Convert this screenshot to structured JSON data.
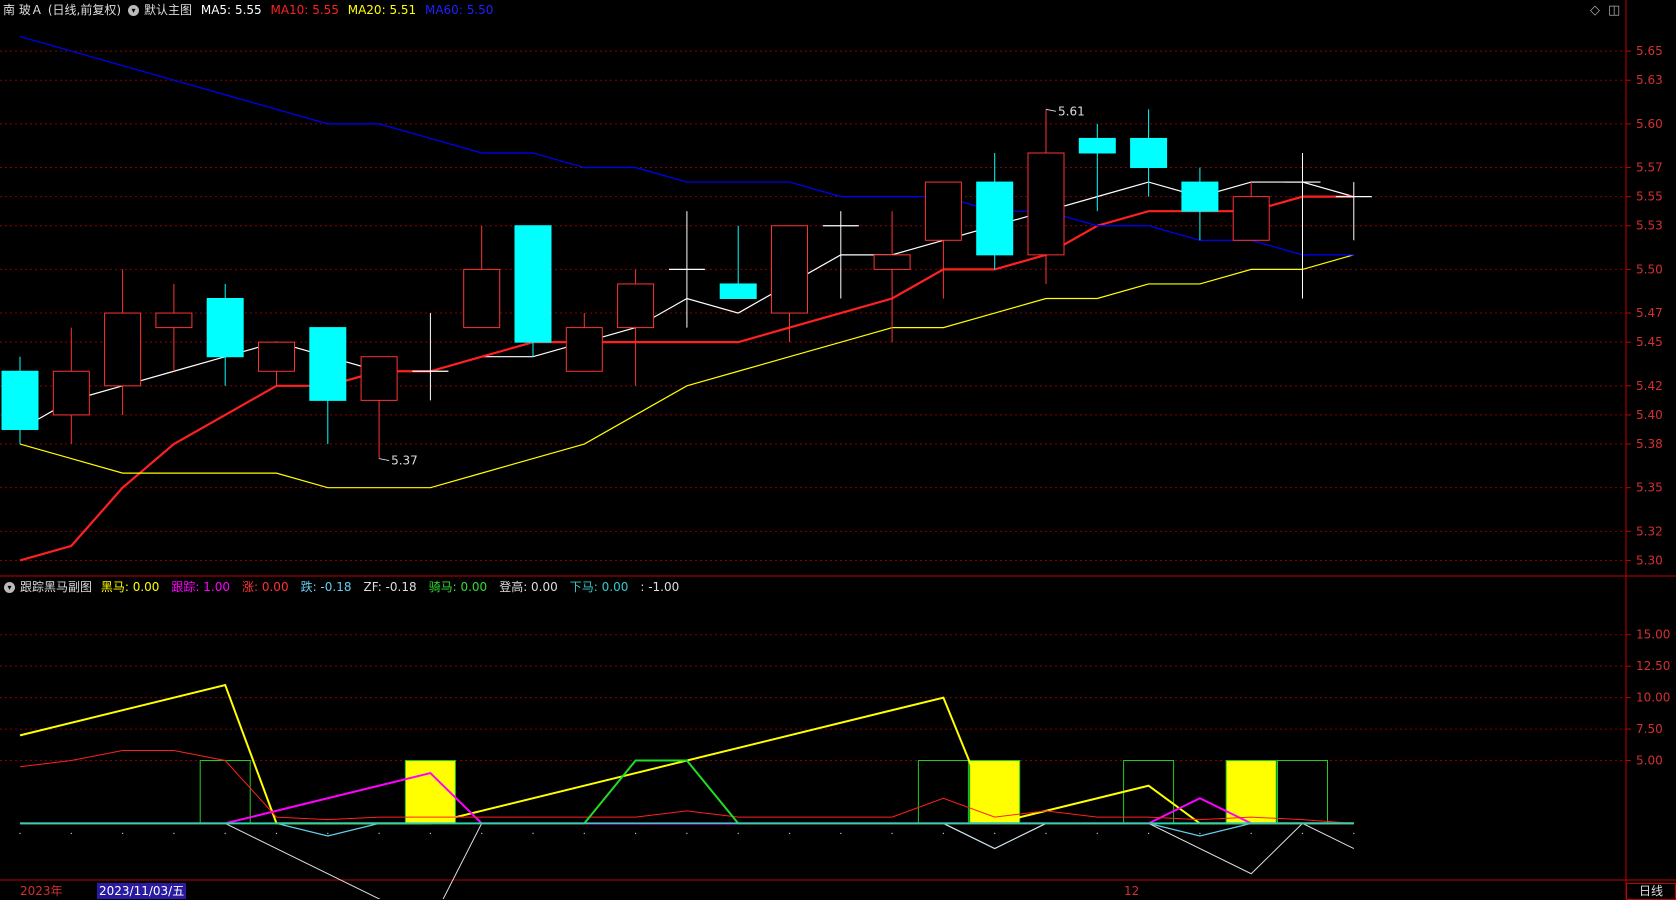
{
  "header": {
    "stock_name": "南 玻Ａ",
    "period": "(日线,前复权)",
    "template": "默认主图",
    "ma5_label": "MA5:",
    "ma5_value": "5.55",
    "ma10_label": "MA10:",
    "ma10_value": "5.55",
    "ma20_label": "MA20:",
    "ma20_value": "5.51",
    "ma60_label": "MA60:",
    "ma60_value": "5.50"
  },
  "sub_header": {
    "title": "跟踪黑马副图",
    "items": [
      {
        "label": "黑马:",
        "value": "0.00",
        "color": "#ffff00"
      },
      {
        "label": "跟踪:",
        "value": "1.00",
        "color": "#ff00ff"
      },
      {
        "label": "涨:",
        "value": "0.00",
        "color": "#ff3333"
      },
      {
        "label": "跌:",
        "value": "-0.18",
        "color": "#66ccee"
      },
      {
        "label": "ZF:",
        "value": "-0.18",
        "color": "#dddddd"
      },
      {
        "label": "骑马:",
        "value": "0.00",
        "color": "#33dd33"
      },
      {
        "label": "登高:",
        "value": "0.00",
        "color": "#dddddd"
      },
      {
        "label": "下马:",
        "value": "0.00",
        "color": "#33cccc"
      },
      {
        "label": ":",
        "value": "-1.00",
        "color": "#dddddd"
      }
    ]
  },
  "price_axis": [
    "5.65",
    "5.63",
    "5.60",
    "5.57",
    "5.55",
    "5.53",
    "5.50",
    "5.47",
    "5.45",
    "5.42",
    "5.40",
    "5.38",
    "5.35",
    "5.32",
    "5.30"
  ],
  "sub_axis": [
    "15.00",
    "12.50",
    "10.00",
    "7.50",
    "5.00"
  ],
  "date_axis": {
    "year": "2023年",
    "cursor_date": "2023/11/03/五",
    "month_mark": "12",
    "period_button": "日线"
  },
  "annotations": {
    "low": "5.37",
    "high": "5.61"
  },
  "colors": {
    "up": "#ff3232",
    "down": "#00ffff",
    "ma5": "#ffffff",
    "ma10": "#ff2020",
    "ma20": "#ffff00",
    "ma60": "#0000ff",
    "axis": "#c00000"
  },
  "chart_data": [
    {
      "type": "candlestick",
      "title": "默认主图",
      "ylim": [
        5.29,
        5.67
      ],
      "candles": [
        {
          "o": 5.43,
          "h": 5.44,
          "l": 5.38,
          "c": 5.39
        },
        {
          "o": 5.4,
          "h": 5.46,
          "l": 5.38,
          "c": 5.43
        },
        {
          "o": 5.42,
          "h": 5.5,
          "l": 5.4,
          "c": 5.47
        },
        {
          "o": 5.46,
          "h": 5.49,
          "l": 5.43,
          "c": 5.47
        },
        {
          "o": 5.48,
          "h": 5.49,
          "l": 5.42,
          "c": 5.44
        },
        {
          "o": 5.43,
          "h": 5.45,
          "l": 5.42,
          "c": 5.45
        },
        {
          "o": 5.46,
          "h": 5.46,
          "l": 5.38,
          "c": 5.41
        },
        {
          "o": 5.41,
          "h": 5.44,
          "l": 5.37,
          "c": 5.44
        },
        {
          "o": 5.43,
          "h": 5.47,
          "l": 5.41,
          "c": 5.43
        },
        {
          "o": 5.46,
          "h": 5.53,
          "l": 5.46,
          "c": 5.5
        },
        {
          "o": 5.53,
          "h": 5.53,
          "l": 5.44,
          "c": 5.45
        },
        {
          "o": 5.43,
          "h": 5.47,
          "l": 5.43,
          "c": 5.46
        },
        {
          "o": 5.46,
          "h": 5.5,
          "l": 5.42,
          "c": 5.49
        },
        {
          "o": 5.5,
          "h": 5.54,
          "l": 5.46,
          "c": 5.5
        },
        {
          "o": 5.49,
          "h": 5.53,
          "l": 5.48,
          "c": 5.48
        },
        {
          "o": 5.47,
          "h": 5.53,
          "l": 5.45,
          "c": 5.53
        },
        {
          "o": 5.53,
          "h": 5.54,
          "l": 5.48,
          "c": 5.53
        },
        {
          "o": 5.5,
          "h": 5.54,
          "l": 5.45,
          "c": 5.51
        },
        {
          "o": 5.52,
          "h": 5.56,
          "l": 5.48,
          "c": 5.56
        },
        {
          "o": 5.56,
          "h": 5.58,
          "l": 5.5,
          "c": 5.51
        },
        {
          "o": 5.51,
          "h": 5.61,
          "l": 5.49,
          "c": 5.58
        },
        {
          "o": 5.59,
          "h": 5.6,
          "l": 5.54,
          "c": 5.58
        },
        {
          "o": 5.59,
          "h": 5.61,
          "l": 5.55,
          "c": 5.57
        },
        {
          "o": 5.56,
          "h": 5.57,
          "l": 5.52,
          "c": 5.54
        },
        {
          "o": 5.52,
          "h": 5.56,
          "l": 5.52,
          "c": 5.55
        },
        {
          "o": 5.56,
          "h": 5.58,
          "l": 5.48,
          "c": 5.56
        },
        {
          "o": 5.55,
          "h": 5.56,
          "l": 5.52,
          "c": 5.55
        }
      ],
      "series": [
        {
          "name": "MA5",
          "values": [
            5.39,
            5.41,
            5.42,
            5.43,
            5.44,
            5.45,
            5.44,
            5.43,
            5.43,
            5.44,
            5.44,
            5.45,
            5.46,
            5.48,
            5.47,
            5.49,
            5.51,
            5.51,
            5.52,
            5.53,
            5.54,
            5.55,
            5.56,
            5.55,
            5.56,
            5.56,
            5.55
          ]
        },
        {
          "name": "MA10",
          "values": [
            5.3,
            5.31,
            5.35,
            5.38,
            5.4,
            5.42,
            5.42,
            5.43,
            5.43,
            5.44,
            5.45,
            5.45,
            5.45,
            5.45,
            5.45,
            5.46,
            5.47,
            5.48,
            5.5,
            5.5,
            5.51,
            5.53,
            5.54,
            5.54,
            5.54,
            5.55,
            5.55
          ]
        },
        {
          "name": "MA20",
          "values": [
            5.38,
            5.37,
            5.36,
            5.36,
            5.36,
            5.36,
            5.35,
            5.35,
            5.35,
            5.36,
            5.37,
            5.38,
            5.4,
            5.42,
            5.43,
            5.44,
            5.45,
            5.46,
            5.46,
            5.47,
            5.48,
            5.48,
            5.49,
            5.49,
            5.5,
            5.5,
            5.51
          ]
        },
        {
          "name": "MA60",
          "values": [
            5.66,
            5.65,
            5.64,
            5.63,
            5.62,
            5.61,
            5.6,
            5.6,
            5.59,
            5.58,
            5.58,
            5.57,
            5.57,
            5.56,
            5.56,
            5.56,
            5.55,
            5.55,
            5.55,
            5.54,
            5.54,
            5.53,
            5.53,
            5.52,
            5.52,
            5.51,
            5.51
          ]
        }
      ]
    },
    {
      "type": "line",
      "title": "跟踪黑马副图",
      "ylim": [
        -4.5,
        18
      ],
      "series": [
        {
          "name": "黑马",
          "values": [
            7.0,
            null,
            null,
            null,
            11.0,
            0.0,
            null,
            null,
            0.0,
            null,
            null,
            null,
            null,
            null,
            null,
            null,
            null,
            null,
            10.0,
            0.0,
            null,
            null,
            3.0,
            0.0,
            0.0,
            0.0,
            0.0
          ]
        },
        {
          "name": "跟踪",
          "values": [
            0,
            null,
            null,
            null,
            0,
            null,
            null,
            null,
            4.0,
            0,
            null,
            null,
            null,
            null,
            null,
            null,
            null,
            null,
            0,
            null,
            null,
            null,
            0,
            2.0,
            0,
            0,
            0
          ]
        },
        {
          "name": "涨",
          "values": [
            4.5,
            5.0,
            5.8,
            5.8,
            5.0,
            0.5,
            0.3,
            0.5,
            0.5,
            0.5,
            0.5,
            0.5,
            0.5,
            1.0,
            0.5,
            0.5,
            0.5,
            0.5,
            2.0,
            0.5,
            1.0,
            0.5,
            0.5,
            0.3,
            0.5,
            0.3,
            0.0
          ]
        },
        {
          "name": "跌",
          "values": [
            0,
            0,
            0,
            0,
            0,
            0,
            -1.0,
            0,
            0,
            0,
            0,
            0,
            0,
            0,
            0,
            0,
            0,
            0,
            0,
            -2.0,
            0,
            0,
            0,
            -1.0,
            0,
            0,
            0
          ]
        },
        {
          "name": "ZF",
          "values": [
            0,
            0,
            0,
            0,
            0,
            null,
            null,
            null,
            -8.0,
            0,
            0,
            0,
            0,
            0,
            0,
            0,
            0,
            0,
            0,
            -2.0,
            0,
            0,
            0,
            null,
            -4.0,
            0,
            -2.0
          ]
        },
        {
          "name": "骑马",
          "values": [
            0,
            0,
            0,
            0,
            0,
            0,
            0,
            0,
            0,
            0,
            0,
            0,
            5.0,
            5.0,
            0,
            0,
            0,
            0,
            0,
            0,
            0,
            0,
            0,
            0,
            0,
            0,
            0
          ]
        },
        {
          "name": "下马",
          "values": [
            0,
            0,
            0,
            0,
            0,
            0,
            0,
            0,
            0,
            0,
            0,
            0,
            0,
            0,
            0,
            0,
            0,
            0,
            0,
            0,
            0,
            0,
            0,
            0,
            0,
            0,
            0
          ]
        }
      ],
      "box_values": [
        null,
        null,
        null,
        null,
        5.0,
        null,
        null,
        null,
        5.0,
        null,
        null,
        null,
        null,
        null,
        null,
        null,
        null,
        null,
        5.0,
        5.0,
        null,
        null,
        5.0,
        null,
        5.0,
        5.0,
        null
      ],
      "box_fill": [
        null,
        null,
        null,
        null,
        "dark",
        null,
        null,
        null,
        "yellow",
        null,
        null,
        null,
        null,
        null,
        null,
        null,
        null,
        null,
        "dark",
        "yellow",
        null,
        null,
        "dark",
        null,
        "yellow",
        "dark",
        null
      ]
    }
  ]
}
